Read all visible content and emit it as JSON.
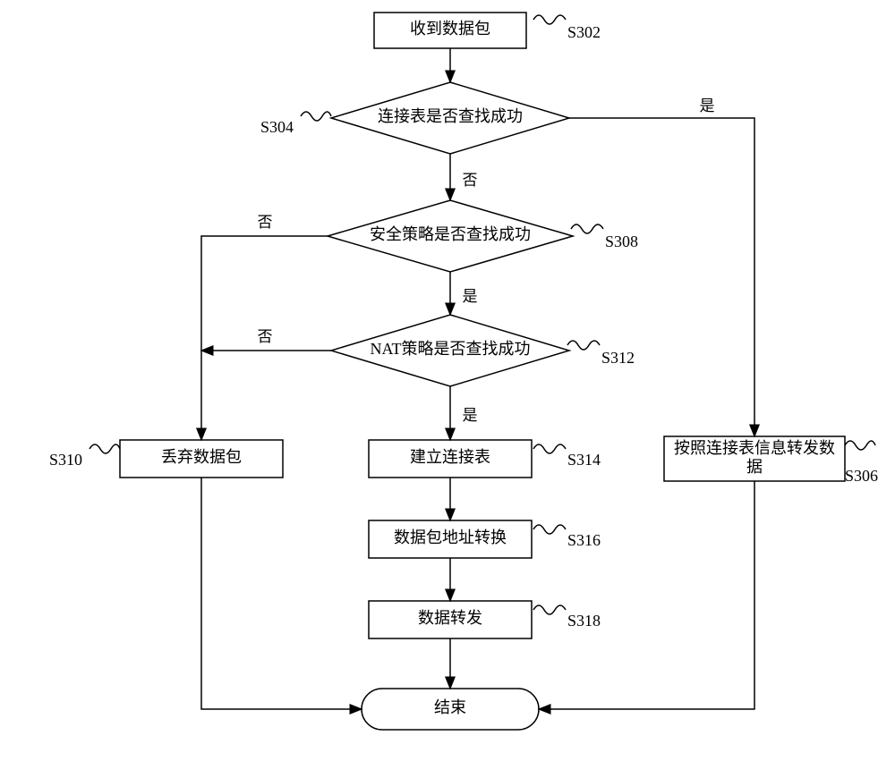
{
  "nodes": {
    "n_recv": {
      "label": "收到数据包",
      "step": "S302"
    },
    "n_conn": {
      "label": "连接表是否查找成功",
      "step": "S304"
    },
    "n_sec": {
      "label": "安全策略是否查找成功",
      "step": "S308"
    },
    "n_nat": {
      "label": "NAT策略是否查找成功",
      "step": "S312"
    },
    "n_drop": {
      "label": "丢弃数据包",
      "step": "S310"
    },
    "n_build": {
      "label": "建立连接表",
      "step": "S314"
    },
    "n_fwdConn": {
      "label_l1": "按照连接表信息转发数",
      "label_l2": "据",
      "step": "S306"
    },
    "n_addr": {
      "label": "数据包地址转换",
      "step": "S316"
    },
    "n_fwd": {
      "label": "数据转发",
      "step": "S318"
    },
    "n_end": {
      "label": "结束"
    }
  },
  "edges": {
    "yes": "是",
    "no": "否"
  }
}
